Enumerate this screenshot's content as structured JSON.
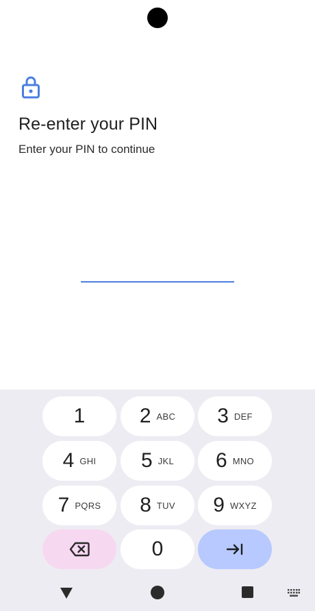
{
  "header": {
    "title": "Re-enter your PIN",
    "subtitle": "Enter your PIN to continue",
    "icon": "lock-icon",
    "accent_color": "#4a7fe0"
  },
  "pin_input": {
    "value": ""
  },
  "keypad": {
    "keys": [
      {
        "digit": "1",
        "letters": ""
      },
      {
        "digit": "2",
        "letters": "ABC"
      },
      {
        "digit": "3",
        "letters": "DEF"
      },
      {
        "digit": "4",
        "letters": "GHI"
      },
      {
        "digit": "5",
        "letters": "JKL"
      },
      {
        "digit": "6",
        "letters": "MNO"
      },
      {
        "digit": "7",
        "letters": "PQRS"
      },
      {
        "digit": "8",
        "letters": "TUV"
      },
      {
        "digit": "9",
        "letters": "WXYZ"
      },
      {
        "digit": "0",
        "letters": ""
      }
    ],
    "delete_icon": "backspace-icon",
    "enter_icon": "tab-arrow-icon",
    "delete_color": "#f7d8f1",
    "enter_color": "#b7c9ff",
    "background_color": "#eeecf3"
  },
  "nav_bar": {
    "back_icon": "back-triangle-icon",
    "home_icon": "home-circle-icon",
    "recents_icon": "recents-square-icon",
    "keyboard_icon": "keyboard-icon"
  }
}
